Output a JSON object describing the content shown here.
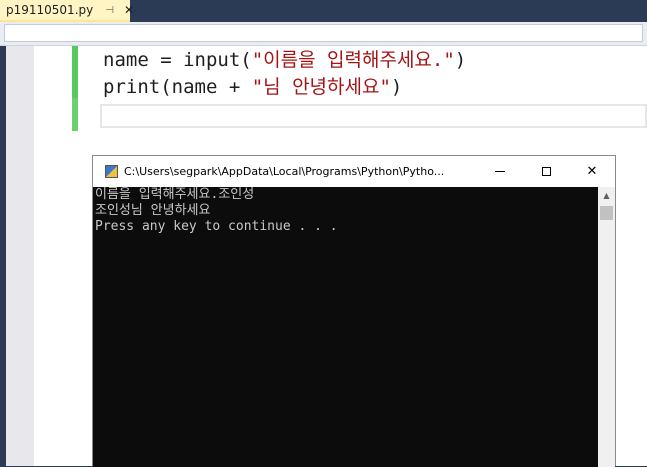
{
  "tab": {
    "filename": "p19110501.py",
    "pin": "⊣",
    "close": "✕"
  },
  "code": {
    "line1_pre": "name = input(",
    "line1_str": "\"이름을 입력해주세요.\"",
    "line1_post": ")",
    "line2_pre": "print(name + ",
    "line2_str": "\"님 안녕하세요\"",
    "line2_post": ")"
  },
  "console": {
    "title": "C:\\Users\\segpark\\AppData\\Local\\Programs\\Python\\Pytho...",
    "lines": [
      "이름을 입력해주세요.조인성",
      "조인성님 안녕하세요",
      "Press any key to continue . . ."
    ]
  },
  "colors": {
    "string": "#a31515",
    "changebar": "#57c95e",
    "console_bg": "#0c0c0c",
    "console_text": "#c8c8c8",
    "tab_active": "#fff4c4"
  }
}
